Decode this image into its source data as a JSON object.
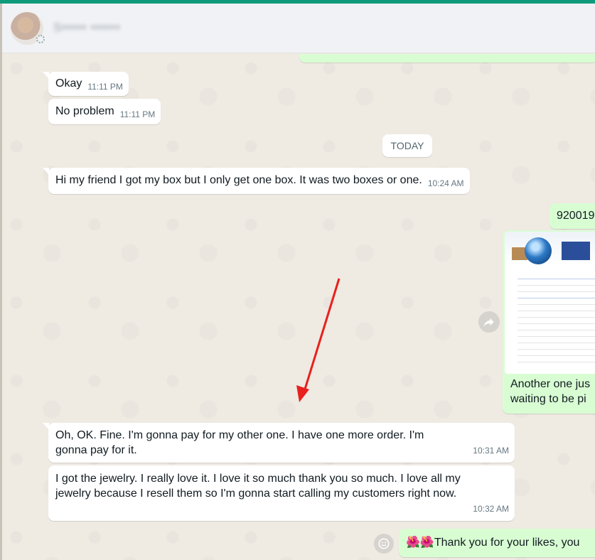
{
  "header": {
    "contact_name": "S••••• ••••••"
  },
  "date_separator": "TODAY",
  "messages": [
    {
      "id": "okay",
      "direction": "in",
      "text": "Okay",
      "time": "11:11 PM"
    },
    {
      "id": "no-problem",
      "direction": "in",
      "text": "No problem",
      "time": "11:11 PM"
    },
    {
      "id": "box",
      "direction": "in",
      "text": "Hi my friend I got my box but I only get one box. It was two boxes or one.",
      "time": "10:24 AM"
    },
    {
      "id": "tracking",
      "direction": "out",
      "text": "920019"
    },
    {
      "id": "image-caption",
      "direction": "out",
      "text_line1": "Another one jus",
      "text_line2": "waiting to be pi"
    },
    {
      "id": "pay",
      "direction": "in",
      "text": "Oh, OK. Fine. I'm gonna pay for my other one. I have one more order. I'm gonna pay for it.",
      "time": "10:31 AM"
    },
    {
      "id": "jewelry",
      "direction": "in",
      "text": "I got the jewelry. I really love it. I love it so much thank you so much. I love all my jewelry because I resell them so I'm gonna start calling my customers right now.",
      "time": "10:32 AM"
    },
    {
      "id": "thanks",
      "direction": "out",
      "text": "🌺🌺Thank you for your likes, you"
    }
  ],
  "colors": {
    "accent": "#0f9b7b",
    "chat_bg": "#efeae2",
    "incoming_bubble": "#ffffff",
    "outgoing_bubble": "#d9fdd3",
    "annotation_arrow": "#e8201e"
  },
  "icons": {
    "forward": "forward-icon",
    "emoji": "smiley-icon"
  }
}
